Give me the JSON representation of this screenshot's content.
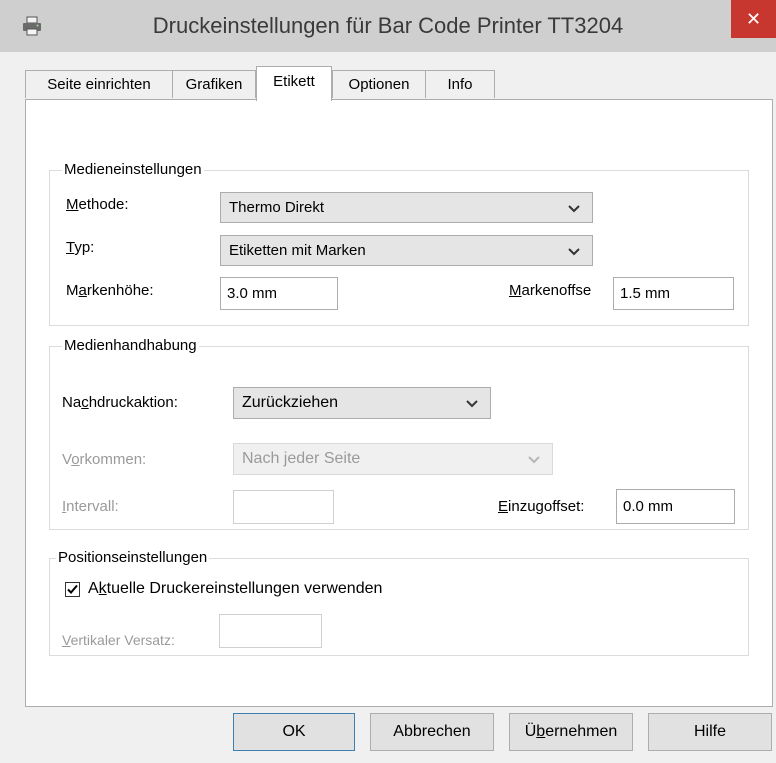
{
  "window": {
    "title": "Druckeinstellungen für Bar Code Printer TT3204",
    "close_glyph": "✕"
  },
  "tabs": [
    {
      "label": "Seite einrichten"
    },
    {
      "label": "Grafiken"
    },
    {
      "label": "Etikett",
      "active": true
    },
    {
      "label": "Optionen"
    },
    {
      "label": "Info"
    }
  ],
  "media_settings": {
    "legend": "Medieneinstellungen",
    "method": {
      "label": "Methode:",
      "value": "Thermo Direkt"
    },
    "type": {
      "label": "Typ:",
      "value": "Etiketten mit Marken"
    },
    "mark_height": {
      "label": "Markenhöhe:",
      "value": "3.0 mm"
    },
    "mark_offset": {
      "label": "Markenoffse",
      "value": "1.5 mm"
    }
  },
  "media_handling": {
    "legend": "Medienhandhabung",
    "post_print_action": {
      "label": "Nachdruckaktion:",
      "value": "Zurückziehen"
    },
    "occurrence": {
      "label": "Vorkommen:",
      "value": "Nach jeder Seite"
    },
    "interval": {
      "label": "Intervall:",
      "value": ""
    },
    "feed_offset": {
      "label": "Einzugoffset:",
      "value": "0.0 mm"
    }
  },
  "position_settings": {
    "legend": "Positionseinstellungen",
    "use_current": {
      "label": "Aktuelle Druckereinstellungen verwenden",
      "checked": true
    },
    "vertical_offset": {
      "label": "Vertikaler Versatz:",
      "value": ""
    }
  },
  "buttons": {
    "ok": "OK",
    "cancel": "Abbrechen",
    "apply": "Übernehmen",
    "help": "Hilfe"
  },
  "icons": {
    "window_icon": "printer-icon",
    "dropdown": "chevron-down-icon",
    "check": "checkmark-icon"
  }
}
